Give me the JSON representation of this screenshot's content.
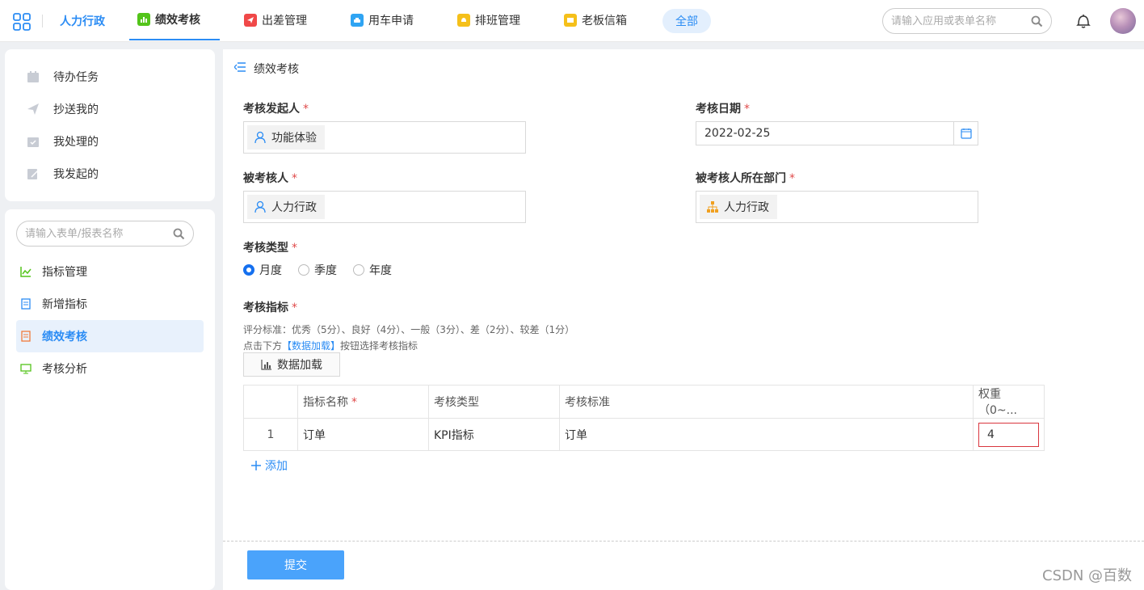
{
  "topbar": {
    "app_name": "人力行政",
    "tabs": [
      {
        "label": "绩效考核",
        "icon": "bar-chart-icon",
        "color": "#53c41a"
      },
      {
        "label": "出差管理",
        "icon": "plane-icon",
        "color": "#f04848"
      },
      {
        "label": "用车申请",
        "icon": "car-icon",
        "color": "#2fa4f3"
      },
      {
        "label": "排班管理",
        "icon": "bell-icon",
        "color": "#f5c01a"
      },
      {
        "label": "老板信箱",
        "icon": "mail-icon",
        "color": "#f5c01a"
      }
    ],
    "all_label": "全部",
    "search_placeholder": "请输入应用或表单名称"
  },
  "sidebar": {
    "tasks": [
      {
        "label": "待办任务",
        "icon": "calendar-icon"
      },
      {
        "label": "抄送我的",
        "icon": "send-icon"
      },
      {
        "label": "我处理的",
        "icon": "inbox-icon"
      },
      {
        "label": "我发起的",
        "icon": "edit-icon"
      }
    ],
    "search_placeholder": "请输入表单/报表名称",
    "menu": [
      {
        "label": "指标管理",
        "icon": "line-chart-icon"
      },
      {
        "label": "新增指标",
        "icon": "document-icon"
      },
      {
        "label": "绩效考核",
        "icon": "form-icon"
      },
      {
        "label": "考核分析",
        "icon": "monitor-icon"
      }
    ]
  },
  "main": {
    "title": "绩效考核",
    "form": {
      "initiator_label": "考核发起人",
      "initiator_value": "功能体验",
      "date_label": "考核日期",
      "date_value": "2022-02-25",
      "assessee_label": "被考核人",
      "assessee_value": "人力行政",
      "dept_label": "被考核人所在部门",
      "dept_value": "人力行政",
      "type_label": "考核类型",
      "type_options": [
        "月度",
        "季度",
        "年度"
      ],
      "type_selected": "月度",
      "indicator_label": "考核指标",
      "hint_line1": "评分标准：优秀（5分）、良好（4分）、一般（3分）、差（2分）、较差（1分）",
      "hint_line2_prefix": "点击下方",
      "hint_line2_highlight": "【数据加载】",
      "hint_line2_suffix": "按钮选择考核指标",
      "load_button": "数据加载",
      "required_mark": "*"
    },
    "table": {
      "headers": [
        "",
        "指标名称",
        "考核类型",
        "考核标准",
        "权重（0~..."
      ],
      "rows": [
        {
          "index": "1",
          "name": "订单",
          "type": "KPI指标",
          "standard": "订单",
          "weight": "4"
        }
      ]
    },
    "add_label": "添加",
    "submit_label": "提交"
  },
  "watermark": "CSDN @百数"
}
